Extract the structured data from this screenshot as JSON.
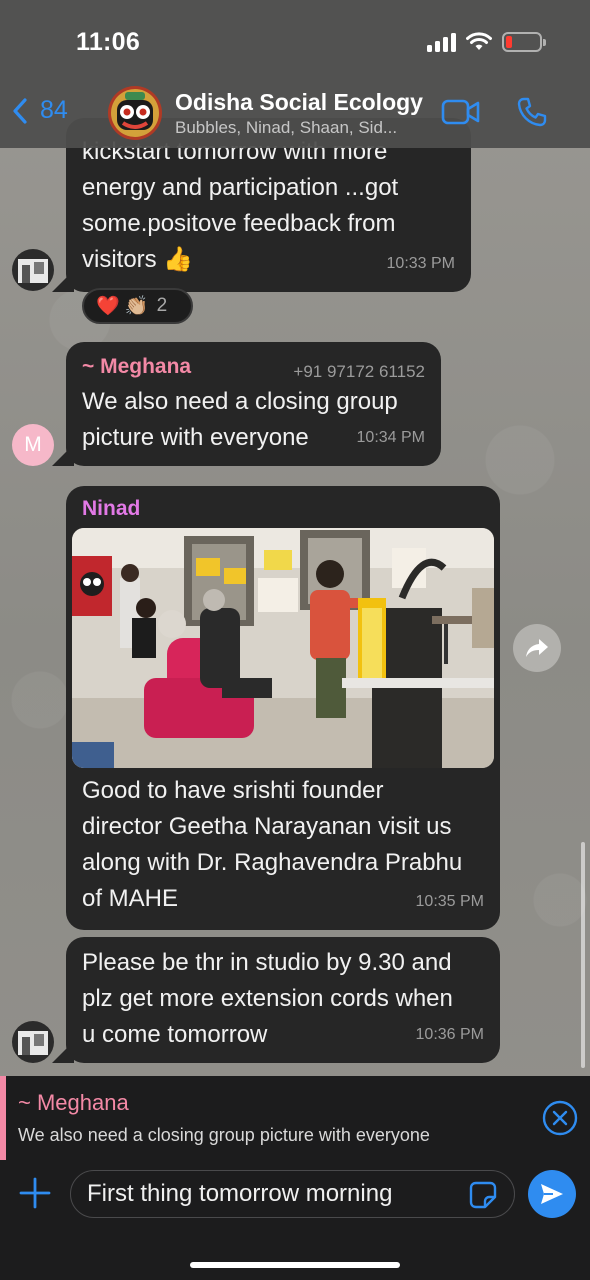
{
  "status_bar": {
    "time": "11:06"
  },
  "header": {
    "back_count": "84",
    "title": "Odisha Social Ecology",
    "subtitle": "Bubbles, Ninad, Shaan, Sid..."
  },
  "messages": [
    {
      "id": "m1",
      "text": "kickstart tomorrow with more\nenergy and participation ...got\nsome.positove feedback from\nvisitors 👍",
      "time": "10:33 PM",
      "reactions": {
        "emojis": "❤️ 👏🏼",
        "count": "2"
      }
    },
    {
      "id": "m2",
      "sender": "~ Meghana",
      "sender_color": "#f389a6",
      "phone": "+91 97172 61152",
      "text": "We also need a closing group\npicture with everyone",
      "time": "10:34 PM",
      "avatar_initial": "M"
    },
    {
      "id": "m3",
      "sender": "Ninad",
      "sender_color": "#e279e6",
      "text": "Good to have srishti founder\ndirector Geetha Narayanan visit us\nalong with Dr. Raghavendra Prabhu\nof MAHE",
      "time": "10:35 PM"
    },
    {
      "id": "m4",
      "text": "Please be thr in studio by 9.30 and\nplz get more extension cords when\nu come tomorrow",
      "time": "10:36 PM"
    }
  ],
  "reply": {
    "name": "~ Meghana",
    "text": "We also need a closing group picture with everyone"
  },
  "composer": {
    "value": "First thing tomorrow morning"
  },
  "colors": {
    "accent": "#2f8cf0",
    "bubble": "#262626",
    "reply_accent": "#f389a6"
  }
}
